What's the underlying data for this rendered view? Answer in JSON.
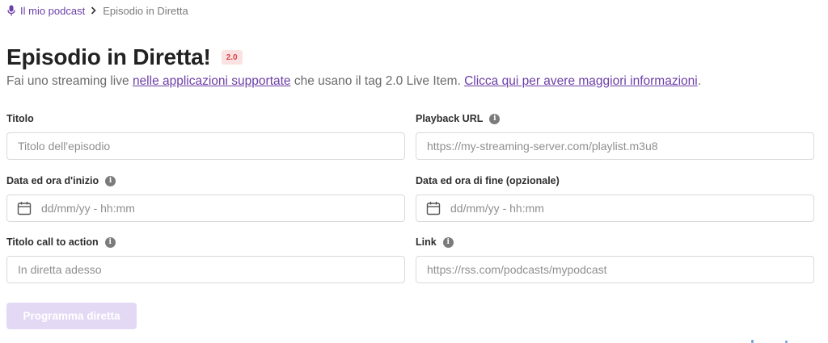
{
  "breadcrumb": {
    "root": "Il mio podcast",
    "current": "Episodio in Diretta"
  },
  "header": {
    "title": "Episodio in Diretta!",
    "badge": "2.0",
    "subtitle_part1": "Fai uno streaming live ",
    "subtitle_link1": "nelle applicazioni supportate",
    "subtitle_part2": " che usano il tag 2.0 Live Item. ",
    "subtitle_link2": "Clicca qui per avere maggiori informazioni",
    "subtitle_part3": "."
  },
  "form": {
    "title_label": "Titolo",
    "title_placeholder": "Titolo dell'episodio",
    "playback_label": "Playback URL",
    "playback_placeholder": "https://my-streaming-server.com/playlist.m3u8",
    "start_label": "Data ed ora d'inizio",
    "start_placeholder": "dd/mm/yy - hh:mm",
    "end_label": "Data ed ora di fine (opzionale)",
    "end_placeholder": "dd/mm/yy - hh:mm",
    "cta_label": "Titolo call to action",
    "cta_placeholder": "In diretta adesso",
    "link_label": "Link",
    "link_placeholder": "https://rss.com/podcasts/mypodcast",
    "submit_label": "Programma diretta",
    "info_glyph": "i"
  },
  "colors": {
    "accent": "#6d3fa8",
    "badge_bg": "#fbe2e2",
    "badge_text": "#d64545",
    "button_disabled": "#e4d9f5"
  },
  "icons": [
    "microphone-icon",
    "chevron-right-icon",
    "info-icon",
    "calendar-icon"
  ]
}
